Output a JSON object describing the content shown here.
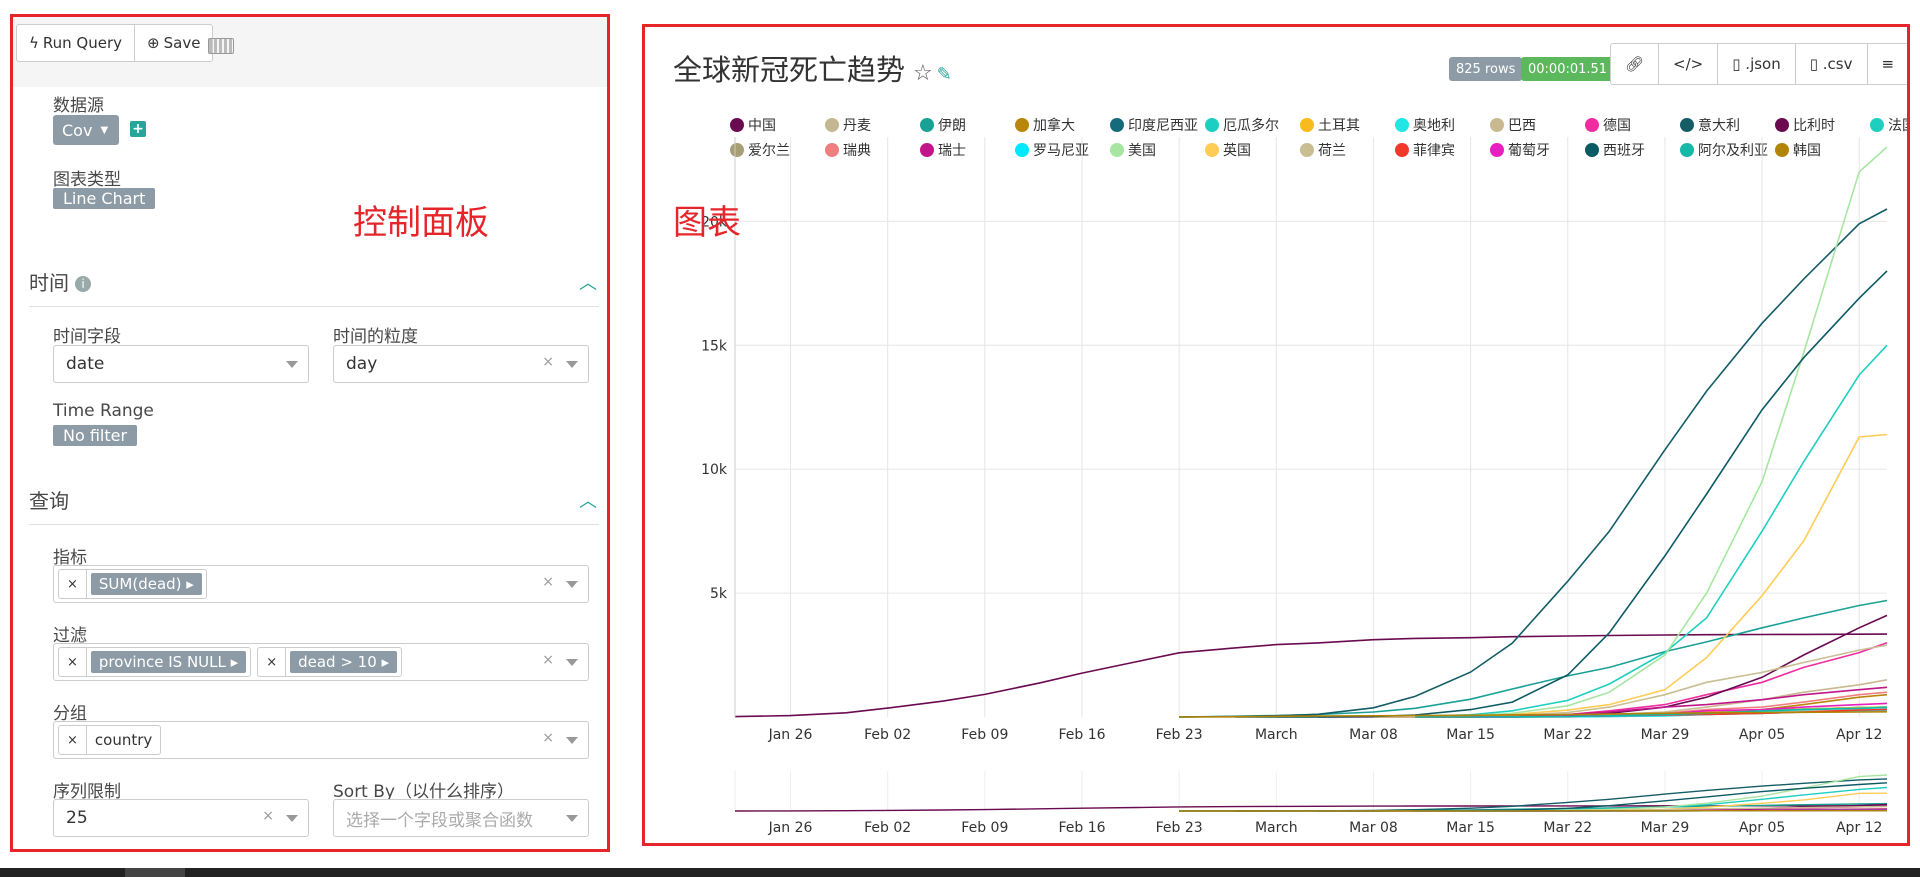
{
  "left_panel": {
    "run_query_label": "Run Query",
    "save_label": "Save",
    "datasource_label": "数据源",
    "datasource_value": "Cov",
    "viz_type_label": "图表类型",
    "viz_type_value": "Line Chart",
    "annotation": "控制面板",
    "time_section": "时间",
    "time_column_label": "时间字段",
    "time_column_value": "date",
    "time_grain_label": "时间的粒度",
    "time_grain_value": "day",
    "time_range_label": "Time Range",
    "time_range_value": "No filter",
    "query_section": "查询",
    "metrics_label": "指标",
    "metric_value": "SUM(dead)",
    "filters_label": "过滤",
    "filter_1": "province IS NULL",
    "filter_2": "dead > 10",
    "groupby_label": "分组",
    "groupby_value": "country",
    "series_limit_label": "序列限制",
    "series_limit_value": "25",
    "sort_by_label": "Sort By（以什么排序）",
    "sort_by_placeholder": "选择一个字段或聚合函数"
  },
  "chart_panel": {
    "title": "全球新冠死亡趋势",
    "annotation": "图表",
    "rows_badge": "825 rows",
    "timer_badge": "00:00:01.51",
    "json_label": ".json",
    "csv_label": ".csv",
    "icons": [
      "link-icon",
      "code-icon",
      "file-json-icon",
      "file-csv-icon",
      "menu-icon",
      "star-icon",
      "edit-icon"
    ],
    "colors": {
      "accent": "#2aa39a",
      "rows_badge": "#8c9ba5",
      "timer_badge": "#5cb85c",
      "annotation": "#e6252a"
    }
  },
  "chart_data": {
    "type": "line",
    "x_ticks": [
      "Jan 26",
      "Feb 02",
      "Feb 09",
      "Feb 16",
      "Feb 23",
      "March",
      "Mar 08",
      "Mar 15",
      "Mar 22",
      "Mar 29",
      "Apr 05",
      "Apr 12"
    ],
    "y_ticks": [
      "5k",
      "10k",
      "15k",
      "20k"
    ],
    "ylim": [
      0,
      23000
    ],
    "x": [
      "Jan 22",
      "Jan 26",
      "Jan 30",
      "Feb 02",
      "Feb 06",
      "Feb 09",
      "Feb 13",
      "Feb 16",
      "Feb 20",
      "Feb 23",
      "Feb 27",
      "March",
      "Mar 04",
      "Mar 08",
      "Mar 11",
      "Mar 15",
      "Mar 18",
      "Mar 22",
      "Mar 25",
      "Mar 29",
      "Apr 01",
      "Apr 05",
      "Apr 08",
      "Apr 12",
      "Apr 14"
    ],
    "grid": true,
    "legend_position": "top",
    "series": [
      {
        "name": "中国",
        "color": "#6a0a50",
        "values": [
          17,
          56,
          170,
          360,
          640,
          910,
          1380,
          1770,
          2240,
          2590,
          2790,
          2920,
          2990,
          3120,
          3170,
          3200,
          3240,
          3270,
          3290,
          3310,
          3320,
          3330,
          3335,
          3340,
          3345
        ]
      },
      {
        "name": "丹麦",
        "color": "#c5b78f",
        "values": [
          null,
          null,
          null,
          null,
          null,
          null,
          null,
          null,
          null,
          null,
          null,
          null,
          null,
          0,
          0,
          0,
          4,
          20,
          50,
          90,
          140,
          180,
          230,
          280,
          300
        ]
      },
      {
        "name": "伊朗",
        "color": "#1aa195",
        "values": [
          null,
          null,
          null,
          null,
          null,
          null,
          null,
          null,
          null,
          0,
          30,
          60,
          100,
          200,
          350,
          720,
          1130,
          1660,
          2000,
          2640,
          3030,
          3600,
          4000,
          4500,
          4700
        ]
      },
      {
        "name": "加拿大",
        "color": "#b8860b",
        "values": [
          null,
          null,
          null,
          null,
          null,
          null,
          null,
          null,
          null,
          null,
          null,
          null,
          null,
          0,
          0,
          1,
          12,
          20,
          40,
          90,
          150,
          300,
          500,
          800,
          900
        ]
      },
      {
        "name": "印度尼西亚",
        "color": "#156b7b",
        "values": [
          null,
          null,
          null,
          null,
          null,
          null,
          null,
          null,
          null,
          null,
          null,
          null,
          null,
          null,
          0,
          0,
          10,
          50,
          100,
          150,
          200,
          260,
          320,
          380,
          400
        ]
      },
      {
        "name": "厄瓜多尔",
        "color": "#1ccfc0",
        "values": [
          null,
          null,
          null,
          null,
          null,
          null,
          null,
          null,
          null,
          null,
          null,
          null,
          null,
          null,
          0,
          0,
          10,
          50,
          100,
          150,
          200,
          260,
          320,
          380,
          400
        ]
      },
      {
        "name": "土耳其",
        "color": "#f7bb1e",
        "values": [
          null,
          null,
          null,
          null,
          null,
          null,
          null,
          null,
          null,
          null,
          null,
          null,
          null,
          null,
          null,
          0,
          0,
          50,
          100,
          150,
          200,
          260,
          320,
          380,
          400
        ]
      },
      {
        "name": "奥地利",
        "color": "#22e6e6",
        "values": [
          null,
          null,
          null,
          null,
          null,
          null,
          null,
          null,
          null,
          null,
          null,
          null,
          null,
          null,
          null,
          0,
          0,
          20,
          50,
          90,
          150,
          220,
          300,
          350,
          390
        ]
      },
      {
        "name": "巴西",
        "color": "#c9b991",
        "values": [
          null,
          null,
          null,
          null,
          null,
          null,
          null,
          null,
          null,
          null,
          null,
          null,
          null,
          null,
          null,
          0,
          10,
          50,
          100,
          200,
          400,
          700,
          1000,
          1300,
          1500
        ]
      },
      {
        "name": "德国",
        "color": "#f02ca0",
        "values": [
          null,
          null,
          null,
          null,
          null,
          null,
          null,
          null,
          null,
          null,
          null,
          null,
          null,
          0,
          2,
          10,
          30,
          100,
          250,
          500,
          900,
          1400,
          2000,
          2600,
          3000
        ]
      },
      {
        "name": "意大利",
        "color": "#145d66",
        "values": [
          null,
          null,
          null,
          null,
          null,
          null,
          null,
          null,
          null,
          0,
          20,
          50,
          110,
          370,
          830,
          1810,
          2980,
          5480,
          7500,
          10780,
          13150,
          15890,
          17670,
          19900,
          20500
        ]
      },
      {
        "name": "比利时",
        "color": "#6a0a50",
        "values": [
          null,
          null,
          null,
          null,
          null,
          null,
          null,
          null,
          null,
          null,
          null,
          null,
          null,
          null,
          null,
          0,
          10,
          50,
          150,
          400,
          800,
          1600,
          2500,
          3600,
          4100
        ]
      },
      {
        "name": "法国",
        "color": "#1ecfc0",
        "values": [
          null,
          null,
          null,
          null,
          null,
          null,
          null,
          null,
          null,
          null,
          null,
          null,
          0,
          10,
          30,
          90,
          250,
          670,
          1330,
          2600,
          4000,
          7500,
          10300,
          13800,
          15000
        ]
      },
      {
        "name": "爱尔兰",
        "color": "#a89e75",
        "values": [
          null,
          null,
          null,
          null,
          null,
          null,
          null,
          null,
          null,
          null,
          null,
          null,
          null,
          null,
          null,
          0,
          0,
          10,
          20,
          50,
          100,
          150,
          200,
          250,
          300
        ]
      },
      {
        "name": "瑞典",
        "color": "#f08080",
        "values": [
          null,
          null,
          null,
          null,
          null,
          null,
          null,
          null,
          null,
          null,
          null,
          null,
          null,
          null,
          0,
          1,
          10,
          30,
          60,
          150,
          300,
          400,
          600,
          900,
          1000
        ]
      },
      {
        "name": "瑞士",
        "color": "#c0168a",
        "values": [
          null,
          null,
          null,
          null,
          null,
          null,
          null,
          null,
          null,
          null,
          null,
          null,
          0,
          2,
          5,
          14,
          30,
          100,
          200,
          400,
          500,
          700,
          900,
          1100,
          1200
        ]
      },
      {
        "name": "罗马尼亚",
        "color": "#00e8ff",
        "values": [
          null,
          null,
          null,
          null,
          null,
          null,
          null,
          null,
          null,
          null,
          null,
          null,
          null,
          null,
          null,
          0,
          0,
          10,
          20,
          50,
          100,
          150,
          200,
          250,
          280
        ]
      },
      {
        "name": "美国",
        "color": "#a6e6a0",
        "values": [
          null,
          null,
          null,
          null,
          null,
          null,
          null,
          null,
          null,
          null,
          null,
          0,
          10,
          20,
          30,
          60,
          150,
          450,
          1000,
          2500,
          5000,
          9500,
          14700,
          22000,
          25000
        ]
      },
      {
        "name": "英国",
        "color": "#ffcc55",
        "values": [
          null,
          null,
          null,
          null,
          null,
          null,
          null,
          null,
          null,
          null,
          null,
          null,
          null,
          0,
          5,
          20,
          100,
          280,
          500,
          1100,
          2400,
          4900,
          7100,
          11300,
          11400
        ]
      },
      {
        "name": "荷兰",
        "color": "#c9bd92",
        "values": [
          null,
          null,
          null,
          null,
          null,
          null,
          null,
          null,
          null,
          null,
          null,
          null,
          null,
          0,
          5,
          20,
          60,
          180,
          400,
          900,
          1400,
          1800,
          2200,
          2700,
          2900
        ]
      },
      {
        "name": "菲律宾",
        "color": "#f2382c",
        "values": [
          null,
          null,
          null,
          null,
          null,
          null,
          null,
          null,
          null,
          null,
          null,
          null,
          null,
          null,
          0,
          5,
          20,
          30,
          50,
          80,
          100,
          150,
          200,
          280,
          300
        ]
      },
      {
        "name": "葡萄牙",
        "color": "#e91ebe",
        "values": [
          null,
          null,
          null,
          null,
          null,
          null,
          null,
          null,
          null,
          null,
          null,
          null,
          null,
          null,
          null,
          0,
          5,
          20,
          50,
          120,
          250,
          300,
          400,
          500,
          550
        ]
      },
      {
        "name": "西班牙",
        "color": "#0c5a64",
        "values": [
          null,
          null,
          null,
          null,
          null,
          null,
          null,
          null,
          null,
          null,
          0,
          0,
          3,
          20,
          80,
          300,
          600,
          1700,
          3400,
          6500,
          9000,
          12400,
          14500,
          16900,
          18000
        ]
      },
      {
        "name": "阿尔及利亚",
        "color": "#14b8a6",
        "values": [
          null,
          null,
          null,
          null,
          null,
          null,
          null,
          null,
          null,
          null,
          null,
          null,
          null,
          null,
          0,
          2,
          10,
          20,
          50,
          100,
          150,
          250,
          300,
          350,
          380
        ]
      },
      {
        "name": "韩国",
        "color": "#b38306",
        "values": [
          null,
          null,
          null,
          null,
          null,
          null,
          null,
          null,
          null,
          0,
          10,
          30,
          40,
          50,
          60,
          70,
          90,
          100,
          120,
          150,
          170,
          180,
          190,
          200,
          210
        ]
      }
    ]
  }
}
